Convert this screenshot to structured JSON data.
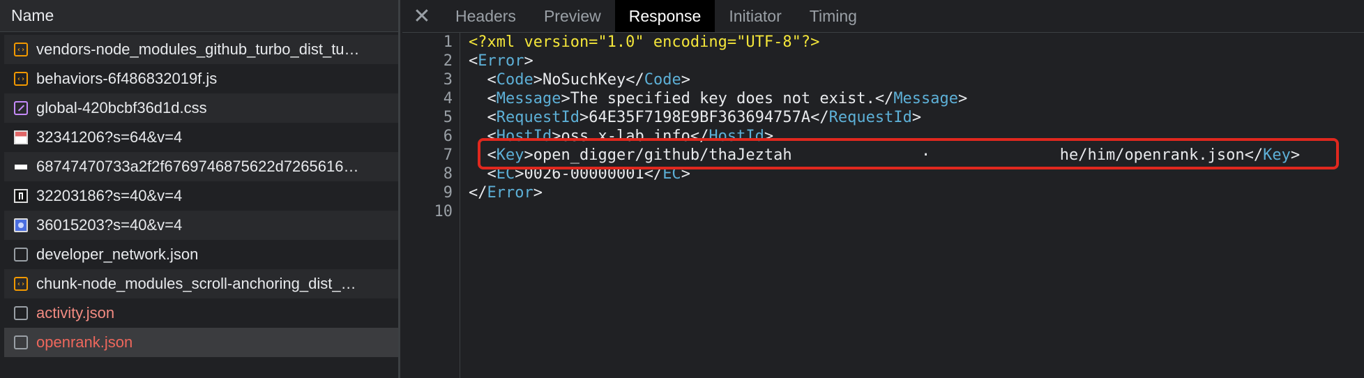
{
  "network": {
    "header": "Name",
    "rows": [
      {
        "name": "vendors-node_modules_github_turbo_dist_tu…",
        "icon": "js-file-icon"
      },
      {
        "name": "behaviors-6f486832019f.js",
        "icon": "js-file-icon"
      },
      {
        "name": "global-420bcbf36d1d.css",
        "icon": "css-file-icon"
      },
      {
        "name": "32341206?s=64&v=4",
        "icon": "image-file-icon"
      },
      {
        "name": "68747470733a2f2f6769746875622d7265616…",
        "icon": "image-file-icon"
      },
      {
        "name": "32203186?s=40&v=4",
        "icon": "image-file-icon"
      },
      {
        "name": "36015203?s=40&v=4",
        "icon": "image-file-icon"
      },
      {
        "name": "developer_network.json",
        "icon": "document-icon"
      },
      {
        "name": "chunk-node_modules_scroll-anchoring_dist_…",
        "icon": "js-file-icon"
      },
      {
        "name": "activity.json",
        "icon": "document-icon",
        "status": "error"
      },
      {
        "name": "openrank.json",
        "icon": "document-icon",
        "status": "error"
      }
    ]
  },
  "tabs": {
    "close": "✕",
    "items": [
      "Headers",
      "Preview",
      "Response",
      "Initiator",
      "Timing"
    ],
    "active": "Response"
  },
  "response": {
    "line_numbers": [
      "1",
      "2",
      "3",
      "4",
      "5",
      "6",
      "7",
      "8",
      "9",
      "10"
    ],
    "l1": "<?xml version=\"1.0\" encoding=\"UTF-8\"?>",
    "l2_tag": "Error",
    "l3_tag": "Code",
    "l3_text": "NoSuchKey",
    "l4_tag": "Message",
    "l4_text": "The specified key does not exist.",
    "l5_tag": "RequestId",
    "l5_text": "64E35F7198E9BF363694757A",
    "l6_tag": "HostId",
    "l6_text": "oss.x-lab.info",
    "l7_tag": "Key",
    "l7_text": "open_digger/github/thaJeztah              ·              he/him/openrank.json",
    "l8_tag": "EC",
    "l8_text": "0026-00000001",
    "l9_tag": "Error"
  },
  "colors": {
    "highlight_box": "#e0281e",
    "xml_tag": "#5db0d7",
    "xml_declaration": "#f4e63a",
    "error_text": "#f28b82"
  }
}
